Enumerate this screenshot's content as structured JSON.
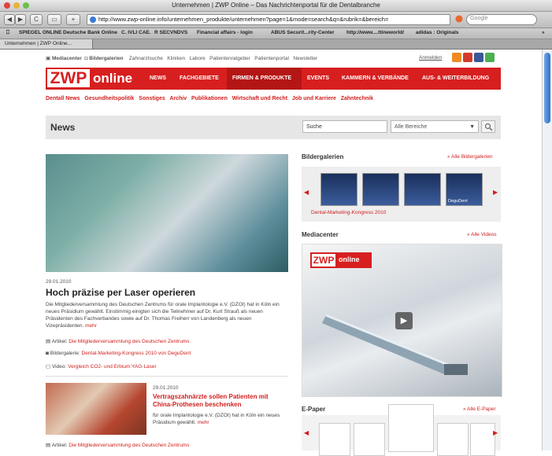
{
  "window": {
    "title": "Unternehmen | ZWP Online – Das Nachrichtenportal für die Dentalbranche"
  },
  "toolbar": {
    "back": "◀",
    "forward": "▶",
    "reload": "C",
    "add": "+",
    "url": "http://www.zwp-online.info/unternehmen_produkte/unternehmen?page=1&mode=search&q=&rubrik=&bereich=",
    "search_placeholder": "Google"
  },
  "bookmarks": [
    "SPIEGEL ONLINE",
    "Deutsche Bank Online",
    "C. IVLI CAE.",
    "R SECVNDVS",
    "Financial affairs - login",
    "ABUS Securit...rity-Center",
    "http://www....ttineworld/",
    "adidas : Originals"
  ],
  "tab": {
    "label": "Unternehmen | ZWP Online..."
  },
  "site": {
    "util_links": {
      "mediacenter": "Mediacenter",
      "bildergalerien": "Bildergalerien",
      "zahnarztsuche": "Zahnarztsuche",
      "kliniken": "Kliniken",
      "labore": "Labore",
      "patientenratgeber": "Patientenratgeber",
      "patientenportal": "Patientenportal",
      "newsletter": "Newsletter",
      "anmelden": "Anmelden"
    },
    "logo": {
      "zwp": "ZWP",
      "online": "online"
    },
    "nav": [
      "NEWS",
      "FACHGEBIETE",
      "FIRMEN & PRODUKTE",
      "EVENTS",
      "KAMMERN & VERBÄNDE",
      "AUS- & WEITERBILDUNG"
    ],
    "subnav": [
      "Dentall News",
      "Gesundheitspolitik",
      "Sonstiges",
      "Archiv",
      "Publikationen",
      "Wirtschaft und Recht",
      "Job und Karriere",
      "Zahntechnik"
    ],
    "news_title": "News",
    "search": {
      "value": "Suche",
      "area": "Alle Bereiche"
    }
  },
  "article1": {
    "date": "29.01.2010",
    "title": "Hoch präzise per Laser operieren",
    "lead": "Die Mitgliederversammlung des Deutschen Zentrums für orale Implantologie e.V. (DZOI) hat in Köln ein neues Präsidium gewählt. Einstimmig einigten sich die Teilnehmer auf Dr. Kurt Strauß als neuen Präsidenten des Fachverbandes sowie auf Dr. Thomas Freiherr von Landenberg als neuen Vizepräsidenten.",
    "more": "mehr",
    "related": [
      {
        "kind": "Artikel:",
        "text": "Die Mitgliederversammlung des Deutschen Zentrums"
      },
      {
        "kind": "Bildergalerie:",
        "text": "Dental-Marketing-Kongress 2010 von DeguDent"
      },
      {
        "kind": "Video:",
        "text": "Vergleich CO2- und Erbium:YAG-Laser"
      }
    ]
  },
  "article2": {
    "date": "29.01.2010",
    "title": "Vertragszahnärzte sollen Patienten mit China-Prothesen beschenken",
    "lead": "für orale Implantologie e.V. (DZOI) hat in Köln ein neues Präsidium gewählt.",
    "more": "mehr",
    "related": [
      {
        "kind": "Artikel:",
        "text": "Die Mitgliederversammlung des Deutschen Zentrums"
      }
    ]
  },
  "sidebar": {
    "galleries": {
      "title": "Bildergalerien",
      "link": "» Alle Bildergalerien",
      "caption": "Dental-Marketing-Kongress 2010",
      "thumb4_label": "DeguDent"
    },
    "media": {
      "title": "Mediacenter",
      "link": "» Alle Videos",
      "logo_zwp": "ZWP",
      "logo_online": "online"
    },
    "epaper": {
      "title": "E-Paper",
      "link": "» Alle E-Paper"
    }
  }
}
